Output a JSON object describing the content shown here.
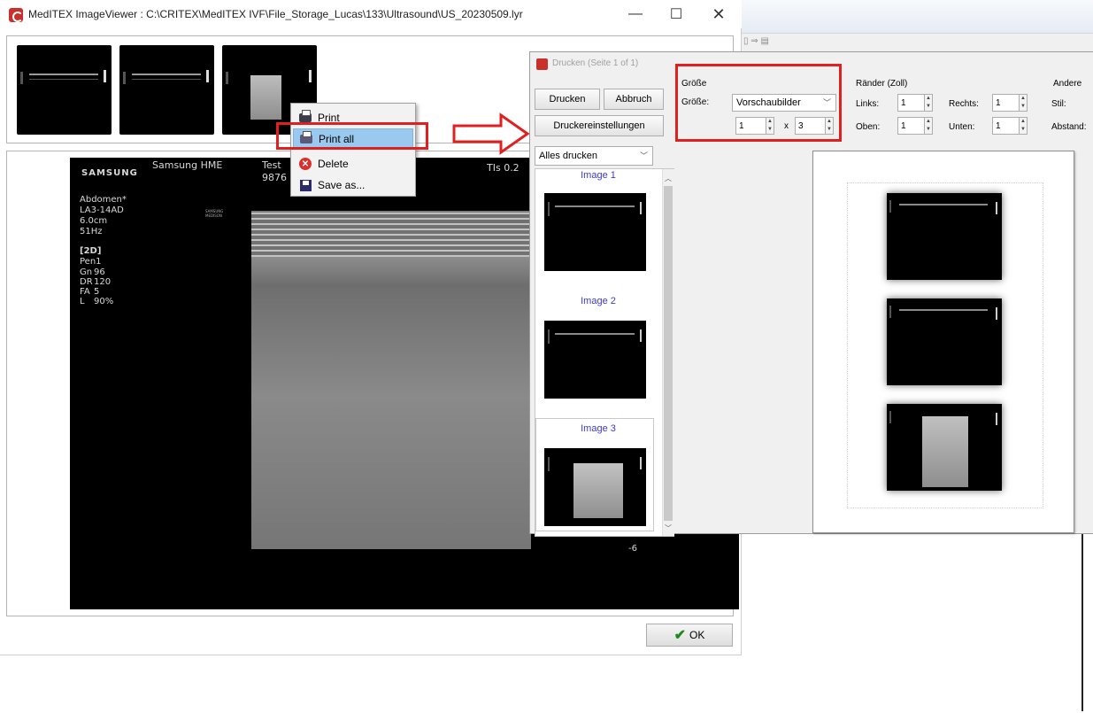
{
  "viewer": {
    "title": "MedITEX ImageViewer : C:\\CRITEX\\MedITEX IVF\\File_Storage_Lucas\\133\\Ultrasound\\US_20230509.lyr",
    "window_controls": {
      "minimize": "—",
      "maximize": "☐",
      "close": "✕"
    },
    "ultrasound": {
      "brand": "SAMSUNG",
      "header": "Samsung HME",
      "patient_name": "Test",
      "patient_id": "9876",
      "ti_value": "TIs  0.2",
      "exam": "Abdomen*",
      "probe": "LA3-14AD",
      "depth": "6.0cm",
      "freq": "51Hz",
      "logo_small": "SAMSUNG\nMEDISON",
      "mode": "[2D]",
      "pen": "Pen1",
      "params": [
        {
          "key": "Gn",
          "value": "96"
        },
        {
          "key": "DR",
          "value": "120"
        },
        {
          "key": "FA",
          "value": "5"
        },
        {
          "key": "L",
          "value": "90%"
        }
      ],
      "scale_mark": "-6"
    },
    "ok_label": "OK"
  },
  "context_menu": {
    "items": [
      {
        "label": "Print",
        "icon": "printer-icon"
      },
      {
        "label": "Print all",
        "icon": "print-all-icon"
      },
      {
        "label": "Delete",
        "icon": "delete-icon"
      },
      {
        "label": "Save as...",
        "icon": "save-icon"
      }
    ]
  },
  "print_dialog": {
    "title": "Drucken (Seite 1 of 1)",
    "buttons": {
      "print": "Drucken",
      "cancel": "Abbruch",
      "printer_settings": "Druckereinstellungen"
    },
    "print_range": "Alles drucken",
    "image_labels": [
      "Image 1",
      "Image 2",
      "Image 3"
    ],
    "size_group": {
      "heading": "Größe",
      "label": "Größe:",
      "value": "Vorschaubilder",
      "cols": "1",
      "x": "x",
      "rows": "3"
    },
    "margins_group": {
      "heading": "Ränder (Zoll)",
      "left_label": "Links:",
      "left_value": "1",
      "right_label": "Rechts:",
      "right_value": "1",
      "top_label": "Oben:",
      "top_value": "1",
      "bottom_label": "Unten:",
      "bottom_value": "1"
    },
    "other_group": {
      "heading": "Andere",
      "style_label": "Stil:",
      "spacing_label": "Abstand:"
    }
  },
  "colors": {
    "annotation_red": "#e02020",
    "selection_blue": "#99c9ef",
    "link_blue": "#3a3ad0"
  }
}
